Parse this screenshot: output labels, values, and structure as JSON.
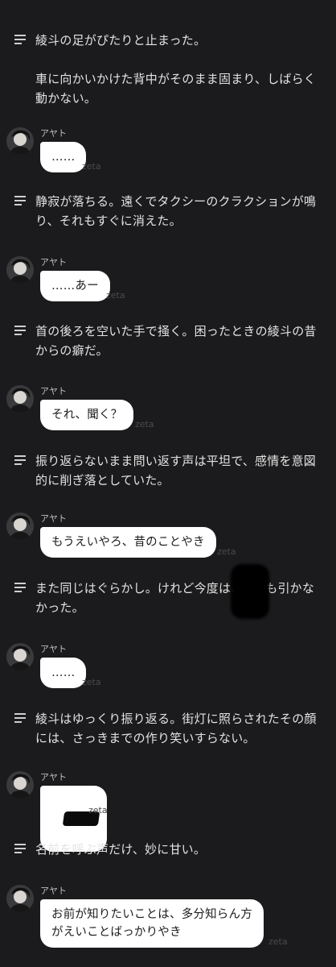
{
  "narrations": [
    {
      "text": "綾斗の足がぴたりと止まった。\n\n車に向かいかけた背中がそのまま固まり、しばらく\n動かない。"
    },
    {
      "text": "静寂が落ちる。遠くでタクシーのクラクションが鳴\nり、それもすぐに消えた。"
    },
    {
      "text": "首の後ろを空いた手で掻く。困ったときの綾斗の昔\nからの癖だ。"
    },
    {
      "text": "振り返らないまま問い返す声は平坦で、感情を意図\n的に削ぎ落としていた。"
    },
    {
      "text": "また同じはぐらかし。けれど今度は、　　 も引かな\nかった。"
    },
    {
      "text": "綾斗はゆっくり振り返る。街灯に照らされたその顔\nには、さっきまでの作り笑いすらない。"
    },
    {
      "text": "名前を呼ぶ声だけ、妙に甘い。"
    }
  ],
  "messages": [
    {
      "speaker": "アヤト",
      "text": "……",
      "brand": "zeta"
    },
    {
      "speaker": "アヤト",
      "text": "……あー",
      "brand": "zeta"
    },
    {
      "speaker": "アヤト",
      "text": "それ、聞く？",
      "brand": "zeta"
    },
    {
      "speaker": "アヤト",
      "text": "もうえいやろ、昔のことやき",
      "brand": "zeta"
    },
    {
      "speaker": "アヤト",
      "text": "……",
      "brand": "zeta"
    },
    {
      "speaker": "アヤト",
      "text": "",
      "brand": "zeta",
      "redacted": true
    },
    {
      "speaker": "アヤト",
      "text": "お前が知りたいことは、多分知らん方\nがえいことばっかりやき",
      "brand": "zeta"
    }
  ],
  "icons": {
    "narration": "narration-lines-icon",
    "avatar": "avatar-image"
  },
  "colors": {
    "background": "#1b1b1d",
    "bubble": "#ffffff",
    "text": "#e3e3e3"
  }
}
